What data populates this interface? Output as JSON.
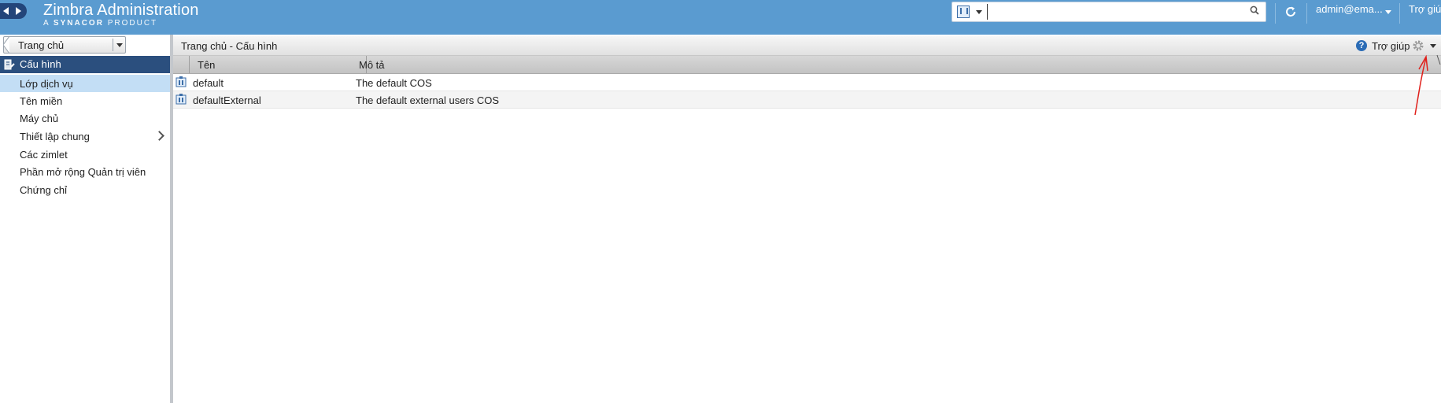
{
  "app": {
    "title": "Zimbra Administration",
    "subtitle_prefix": "A",
    "subtitle_brand": "SYNACOR",
    "subtitle_suffix": "PRODUCT"
  },
  "topbar": {
    "search": {
      "value": "",
      "placeholder": ""
    },
    "user_label": "admin@ema...",
    "help_label": "Trợ giúp"
  },
  "sidebar": {
    "home_button": "Trang chủ",
    "section": {
      "label": "Cấu hình",
      "icon": "config-icon"
    },
    "items": [
      {
        "label": "Lớp dịch vụ",
        "selected": true
      },
      {
        "label": "Tên miền"
      },
      {
        "label": "Máy chủ"
      },
      {
        "label": "Thiết lập chung",
        "has_submenu": true
      },
      {
        "label": "Các zimlet"
      },
      {
        "label": "Phần mở rộng Quản trị viên"
      },
      {
        "label": "Chứng chỉ"
      }
    ]
  },
  "main": {
    "breadcrumb": "Trang chủ - Cấu hình",
    "help_label": "Trợ giúp",
    "columns": [
      "Tên",
      "Mô tả"
    ],
    "rows": [
      {
        "name": "default",
        "description": "The default COS",
        "icon": "cos-icon"
      },
      {
        "name": "defaultExternal",
        "description": "The default external users COS",
        "icon": "cos-icon"
      }
    ]
  },
  "colors": {
    "topbar": "#5a9bd0",
    "sidebar_section": "#2b4f7e",
    "sidebar_selected": "#c3def5",
    "annotation": "#e0201b"
  }
}
